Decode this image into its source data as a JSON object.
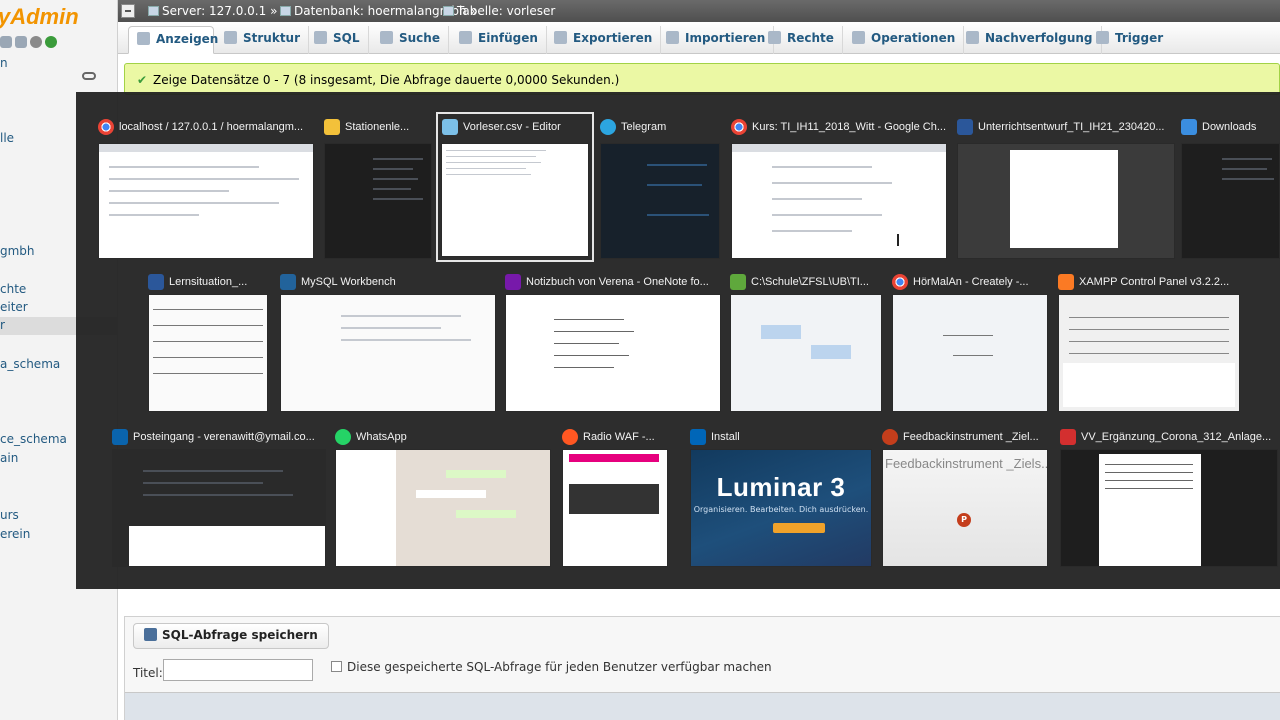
{
  "pma": {
    "logo": "yAdmin",
    "nav_items": [
      "n",
      "lle",
      "gmbh",
      "chte",
      "eiter",
      "r",
      "a_schema",
      "ce_schema",
      "ain",
      "urs",
      "erein"
    ],
    "breadcrumb": {
      "server": "Server: 127.0.0.1 »",
      "database": "Datenbank: hoermalangmbh »",
      "table": "Tabelle: vorleser"
    },
    "tabs": [
      {
        "label": "Anzeigen",
        "icon": "table-icon",
        "active": true
      },
      {
        "label": "Struktur",
        "icon": "structure-icon"
      },
      {
        "label": "SQL",
        "icon": "sql-icon"
      },
      {
        "label": "Suche",
        "icon": "search-icon"
      },
      {
        "label": "Einfügen",
        "icon": "insert-icon"
      },
      {
        "label": "Exportieren",
        "icon": "export-icon"
      },
      {
        "label": "Importieren",
        "icon": "import-icon"
      },
      {
        "label": "Rechte",
        "icon": "privileges-icon"
      },
      {
        "label": "Operationen",
        "icon": "wrench-icon"
      },
      {
        "label": "Nachverfolgung",
        "icon": "eye-icon"
      },
      {
        "label": "Trigger",
        "icon": "trigger-icon"
      }
    ],
    "success_message": "Zeige Datensätze 0 - 7 (8 insgesamt, Die Abfrage dauerte 0,0000 Sekunden.)",
    "save_query": {
      "legend": "SQL-Abfrage speichern",
      "title_label": "Titel:",
      "title_value": "",
      "public_label": "Diese gespeicherte SQL-Abfrage für jeden Benutzer verfügbar machen"
    }
  },
  "switcher": {
    "rows": [
      [
        {
          "title": "localhost / 127.0.0.1 / hoermalangm...",
          "icon": "chrome-icon",
          "thumb": "browser"
        },
        {
          "title": "Stationenle...",
          "icon": "folder-icon",
          "thumb": "dark"
        },
        {
          "title": "Vorleser.csv - Editor",
          "icon": "notepad-icon",
          "thumb": "notepad",
          "selected": true
        },
        {
          "title": "Telegram",
          "icon": "telegram-icon",
          "thumb": "telegram"
        },
        {
          "title": "Kurs: TI_IH11_2018_Witt - Google Ch...",
          "icon": "chrome-icon",
          "thumb": "browser"
        },
        {
          "title": "Unterrichtsentwurf_TI_IH21_230420...",
          "icon": "word-icon",
          "thumb": "word"
        },
        {
          "title": "Downloads",
          "icon": "downloads-icon",
          "thumb": "dark"
        }
      ],
      [
        {
          "title": "Lernsituation_...",
          "icon": "word-icon",
          "thumb": "word-table"
        },
        {
          "title": "MySQL Workbench",
          "icon": "mysql-workbench-icon",
          "thumb": "white"
        },
        {
          "title": "Notizbuch von Verena - OneNote fo...",
          "icon": "onenote-icon",
          "thumb": "onenote"
        },
        {
          "title": "C:\\Schule\\ZFSL\\UB\\TI...",
          "icon": "explorer-icon",
          "thumb": "creately"
        },
        {
          "title": "HörMalAn - Creately -...",
          "icon": "chrome-icon",
          "thumb": "creately"
        },
        {
          "title": "XAMPP Control Panel v3.2.2...",
          "icon": "xampp-icon",
          "thumb": "xampp"
        }
      ],
      [
        {
          "title": "Posteingang - verenawitt@ymail.co...",
          "icon": "mail-icon",
          "thumb": "mail"
        },
        {
          "title": "WhatsApp",
          "icon": "whatsapp-icon",
          "thumb": "whatsapp"
        },
        {
          "title": "Radio WAF -...",
          "icon": "radio-icon",
          "thumb": "radio"
        },
        {
          "title": "Install",
          "icon": "install-icon",
          "thumb": "luminar"
        },
        {
          "title": "Feedbackinstrument _Ziel...",
          "icon": "powerpoint-icon",
          "thumb": "ppt"
        },
        {
          "title": "VV_Ergänzung_Corona_312_Anlage...",
          "icon": "pdf-icon",
          "thumb": "pdf"
        }
      ]
    ],
    "luminar": {
      "title": "Luminar 3",
      "subtitle": "Organisieren. Bearbeiten. Dich ausdrücken."
    },
    "ppt_preview_text": "Feedbackinstrument _Ziels...",
    "ppt_logo": "P"
  },
  "colors": {
    "pma_orange": "#f29400",
    "pma_link": "#235a81",
    "success_bg": "#ebf8a4",
    "switcher_bg": "#202020"
  }
}
